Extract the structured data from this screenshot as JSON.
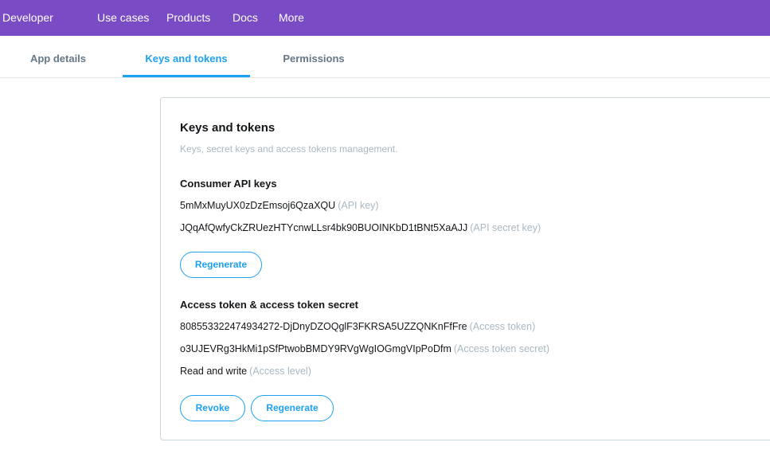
{
  "topnav": {
    "brand": "Developer",
    "items": [
      "Use cases",
      "Products",
      "Docs",
      "More"
    ]
  },
  "tabs": [
    {
      "label": "App details",
      "active": false
    },
    {
      "label": "Keys and tokens",
      "active": true
    },
    {
      "label": "Permissions",
      "active": false
    }
  ],
  "card": {
    "title": "Keys and tokens",
    "subtitle": "Keys, secret keys and access tokens management.",
    "consumer": {
      "heading": "Consumer API keys",
      "api_key": {
        "value": "5mMxMuyUX0zDzEmsoj6QzaXQU",
        "hint": "(API key)"
      },
      "api_secret": {
        "value": "JQqAfQwfyCkZRUezHTYcnwLLsr4bk90BUOINKbD1tBNt5XaAJJ",
        "hint": "(API secret key)"
      },
      "regenerate_label": "Regenerate"
    },
    "access": {
      "heading": "Access token & access token secret",
      "token": {
        "value": "808553322474934272-DjDnyDZOQglF3FKRSA5UZZQNKnFfFre",
        "hint": "(Access token)"
      },
      "secret": {
        "value": "o3UJEVRg3HkMi1pSfPtwobBMDY9RVgWgIOGmgVIpPoDfm",
        "hint": "(Access token secret)"
      },
      "level": {
        "value": "Read and write",
        "hint": "(Access level)"
      },
      "revoke_label": "Revoke",
      "regenerate_label": "Regenerate"
    }
  },
  "colors": {
    "topbar": "#794bc4",
    "accent": "#1da1f2",
    "muted": "#aab8c2",
    "tab_inactive": "#657786"
  }
}
